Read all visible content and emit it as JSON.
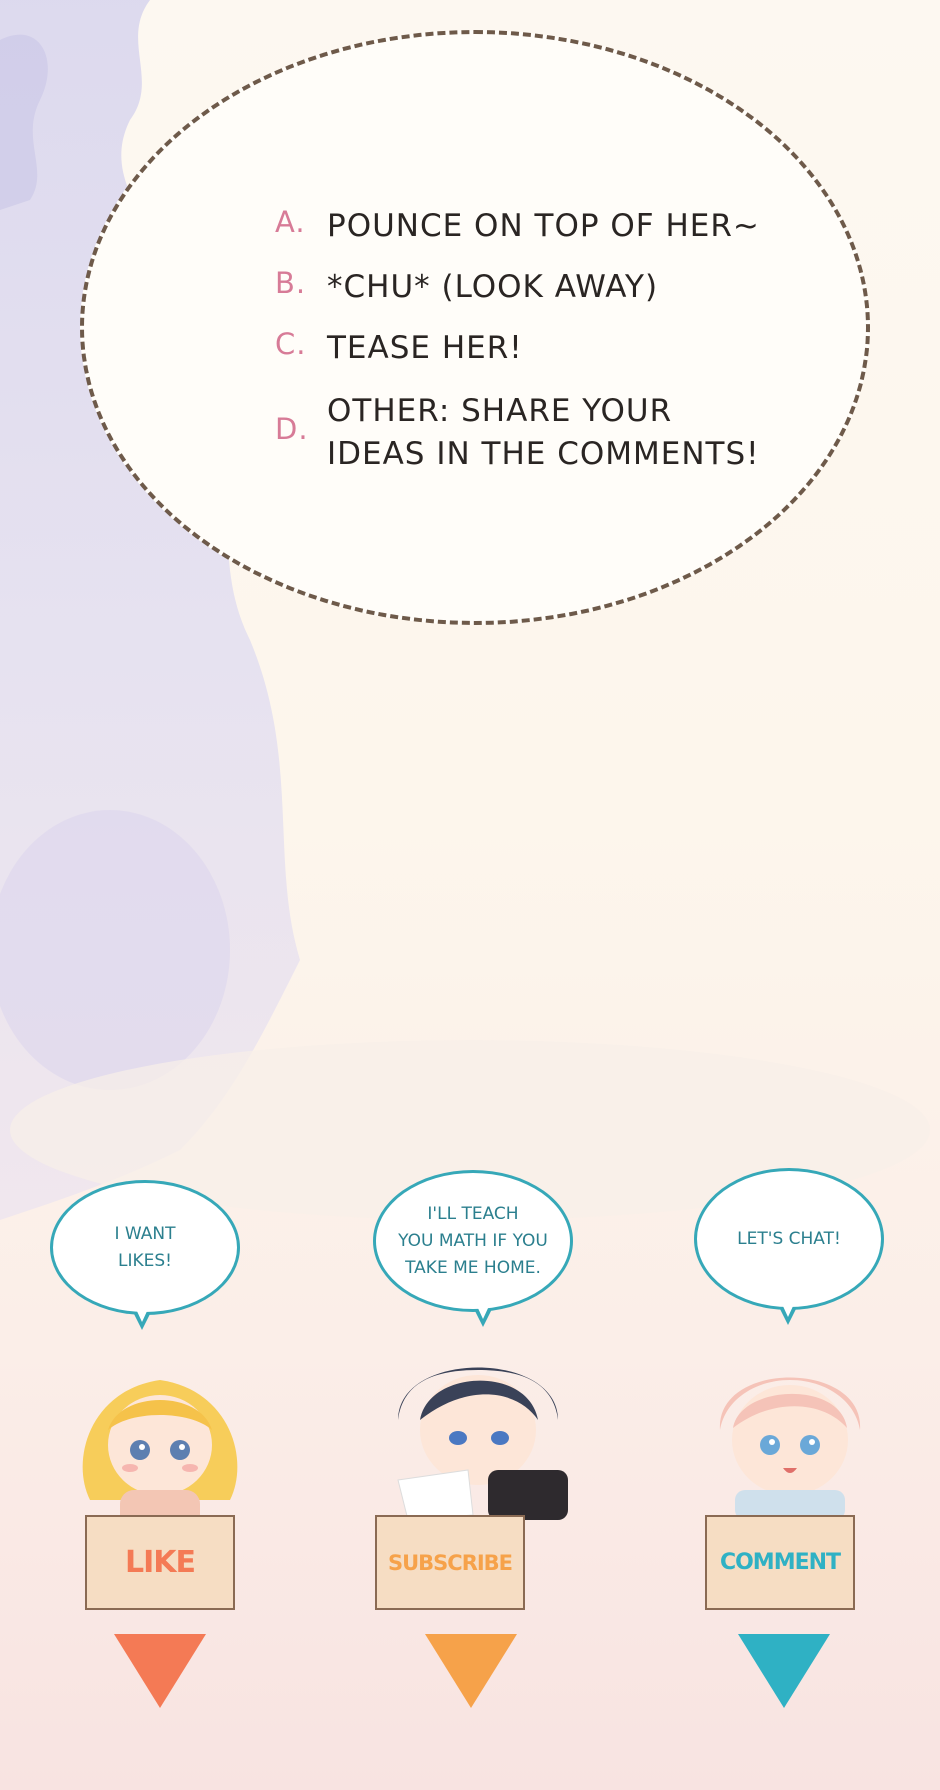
{
  "poll": {
    "options": [
      {
        "letter": "A.",
        "text": "POUNCE ON TOP OF HER~"
      },
      {
        "letter": "B.",
        "text": "*CHU* (LOOK AWAY)"
      },
      {
        "letter": "C.",
        "text": "TEASE HER!"
      },
      {
        "letter": "D.",
        "text": "OTHER: SHARE YOUR\nIDEAS IN THE COMMENTS!"
      }
    ]
  },
  "cta": [
    {
      "bubble": "I WANT\nLIKES!",
      "button": "LIKE",
      "color": "#f47a55",
      "hair": "#f7cd5a"
    },
    {
      "bubble": "I'LL TEACH\nYOU MATH IF YOU\nTAKE ME HOME.",
      "button": "SUBSCRIBE",
      "color": "#f6a24a",
      "hair": "#3a4258"
    },
    {
      "bubble": "LET'S CHAT!",
      "button": "COMMENT",
      "color": "#2fb1c4",
      "hair": "#f5c3b8"
    }
  ],
  "colors": {
    "outline": "#6e5a4a",
    "letter": "#d77b97",
    "speech": "#36a8b8"
  }
}
